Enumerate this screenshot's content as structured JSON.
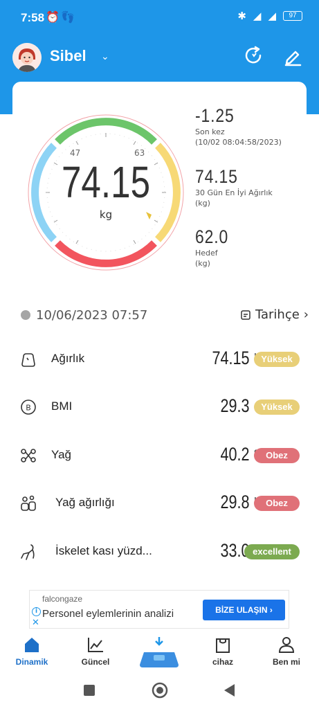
{
  "status_bar": {
    "time": "7:58",
    "battery": "97"
  },
  "header": {
    "user_name": "Sibel"
  },
  "gauge": {
    "weight": "74.15",
    "unit": "kg",
    "tick_low": "47",
    "tick_high": "63"
  },
  "stats": [
    {
      "value": "-1.25",
      "label1": "Son kez",
      "label2": "(10/02 08:04:58/2023)"
    },
    {
      "value": "74.15",
      "label1": "30 Gün En İyi Ağırlık",
      "label2": "(kg)"
    },
    {
      "value": "62.0",
      "label1": "Hedef",
      "label2": "(kg)"
    }
  ],
  "date_row": {
    "datetime": "10/06/2023 07:57",
    "history_label": "Tarihçe"
  },
  "metrics": [
    {
      "name": "Ağırlık",
      "value": "74.15",
      "unit": "kg",
      "status": "Yüksek",
      "status_color": "#e8cf78"
    },
    {
      "name": "BMI",
      "value": "29.3",
      "unit": "",
      "status": "Yüksek",
      "status_color": "#e8cf78"
    },
    {
      "name": "Yağ",
      "value": "40.2",
      "unit": "%",
      "status": "Obez",
      "status_color": "#e07178"
    },
    {
      "name": "Yağ ağırlığı",
      "value": "29.8",
      "unit": "kg",
      "status": "Obez",
      "status_color": "#e07178"
    },
    {
      "name": "İskelet kası yüzd...",
      "value": "33.0",
      "unit": "%",
      "status": "excellent",
      "status_color": "#7caa50"
    }
  ],
  "ad": {
    "brand": "falcongaze",
    "text": "Personel eylemlerinin analizi",
    "button": "BİZE ULAŞIN"
  },
  "tabs": [
    {
      "label": "Dinamik",
      "icon": "home-icon",
      "active": true
    },
    {
      "label": "Güncel",
      "icon": "chart-line-icon",
      "active": false
    },
    {
      "label": "",
      "icon": "scale-icon",
      "active": false
    },
    {
      "label": "cihaz",
      "icon": "bag-icon",
      "active": false
    },
    {
      "label": "Ben mi",
      "icon": "person-icon",
      "active": false
    }
  ],
  "colors": {
    "primary": "#1e96e8",
    "gauge_green": "#6cc56a",
    "gauge_yellow": "#f7d976",
    "gauge_red": "#f2555e",
    "gauge_blue": "#8dd3f5"
  }
}
